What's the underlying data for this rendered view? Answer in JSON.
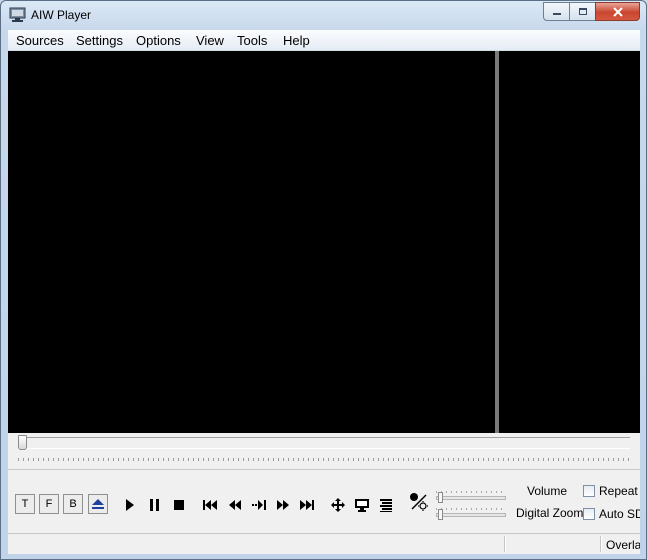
{
  "window": {
    "title": "AIW Player"
  },
  "menu": {
    "items": [
      "Sources",
      "Settings",
      "Options",
      "View",
      "Tools",
      "Help"
    ]
  },
  "seek": {
    "position": 0
  },
  "controls": {
    "tfb": [
      "T",
      "F",
      "B"
    ],
    "icons": [
      "eject-icon",
      "play-icon",
      "pause-icon",
      "stop-icon",
      "skip-back-icon",
      "rewind-icon",
      "step-forward-icon",
      "fast-forward-icon",
      "skip-forward-icon",
      "move-icon",
      "monitor-icon",
      "list-icon",
      "brightness-icon"
    ],
    "volume_label": "Volume",
    "zoom_label": "Digital Zoom",
    "repeat_label": "Repeat",
    "autosd_label": "Auto SD",
    "repeat_checked": false,
    "autosd_checked": false
  },
  "status": {
    "overlay_text": "Overlay"
  },
  "colors": {
    "video_bg": "#000000",
    "frame": "#c0d3e8",
    "eject": "#1f3f9e"
  }
}
